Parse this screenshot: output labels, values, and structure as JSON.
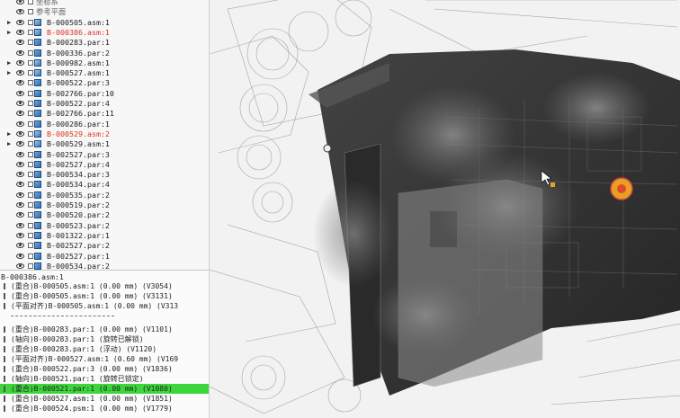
{
  "tree": {
    "top_items": [
      "坐标系",
      "参考平面"
    ],
    "rows": [
      {
        "label": "B-000505.asm:1",
        "kind": "asm",
        "expand": "▶",
        "state": "normal"
      },
      {
        "label": "B-000386.asm:1",
        "kind": "asm",
        "expand": "▶",
        "state": "red"
      },
      {
        "label": "B-000283.par:1",
        "kind": "par",
        "expand": "",
        "state": "normal"
      },
      {
        "label": "B-000336.par:2",
        "kind": "par",
        "expand": "",
        "state": "normal"
      },
      {
        "label": "B-000982.asm:1",
        "kind": "asm",
        "expand": "▶",
        "state": "normal"
      },
      {
        "label": "B-000527.asm:1",
        "kind": "asm",
        "expand": "▶",
        "state": "normal"
      },
      {
        "label": "B-000522.par:3",
        "kind": "par",
        "expand": "",
        "state": "normal"
      },
      {
        "label": "B-002766.par:10",
        "kind": "par",
        "expand": "",
        "state": "normal"
      },
      {
        "label": "B-000522.par:4",
        "kind": "par",
        "expand": "",
        "state": "normal"
      },
      {
        "label": "B-002766.par:11",
        "kind": "par",
        "expand": "",
        "state": "normal"
      },
      {
        "label": "B-000286.par:1",
        "kind": "par",
        "expand": "",
        "state": "normal"
      },
      {
        "label": "B-000529.asm:2",
        "kind": "asm",
        "expand": "▶",
        "state": "red"
      },
      {
        "label": "B-000529.asm:1",
        "kind": "asm",
        "expand": "▶",
        "state": "normal"
      },
      {
        "label": "B-002527.par:3",
        "kind": "par",
        "expand": "",
        "state": "normal"
      },
      {
        "label": "B-002527.par:4",
        "kind": "par",
        "expand": "",
        "state": "normal"
      },
      {
        "label": "B-000534.par:3",
        "kind": "par",
        "expand": "",
        "state": "normal"
      },
      {
        "label": "B-000534.par:4",
        "kind": "par",
        "expand": "",
        "state": "normal"
      },
      {
        "label": "B-000535.par:2",
        "kind": "par",
        "expand": "",
        "state": "normal"
      },
      {
        "label": "B-000519.par:2",
        "kind": "par",
        "expand": "",
        "state": "normal"
      },
      {
        "label": "B-000520.par:2",
        "kind": "par",
        "expand": "",
        "state": "normal"
      },
      {
        "label": "B-000523.par:2",
        "kind": "par",
        "expand": "",
        "state": "normal"
      },
      {
        "label": "B-001322.par:1",
        "kind": "par",
        "expand": "",
        "state": "normal"
      },
      {
        "label": "B-002527.par:2",
        "kind": "par",
        "expand": "",
        "state": "normal"
      },
      {
        "label": "B-002527.par:1",
        "kind": "par",
        "expand": "",
        "state": "normal"
      },
      {
        "label": "B-000534.par:2",
        "kind": "par",
        "expand": "",
        "state": "normal"
      }
    ]
  },
  "constraints": {
    "title": "B-000386.asm:1",
    "rows": [
      {
        "text": "(重合)B-000505.asm:1   (0.00 mm)   (V3054)",
        "hl": false
      },
      {
        "text": "(重合)B-000505.asm:1   (0.00 mm)   (V3131)",
        "hl": false
      },
      {
        "text": "(平面对齐)B-000505.asm:1   (0.00 mm)   (V313",
        "hl": false
      },
      {
        "text": "(重合)B-000283.par:1   (0.00 mm)   (V1101)",
        "hl": false
      },
      {
        "text": "(轴向)B-000283.par:1     (旋转已解锁)",
        "hl": false
      },
      {
        "text": "(重合)B-000283.par:1     (浮动)   (V1120)",
        "hl": false
      },
      {
        "text": "(平面对齐)B-000527.asm:1   (0.60 mm)   (V169",
        "hl": false
      },
      {
        "text": "(重合)B-000522.par:3   (0.00 mm)   (V1836)",
        "hl": false
      },
      {
        "text": "(轴向)B-000521.par:1     (旋转已锁定)",
        "hl": false
      },
      {
        "text": "(重合)B-000521.par:1   (0.00 mm)   (V1080)",
        "hl": true
      },
      {
        "text": "(重合)B-000527.asm:1   (0.00 mm)   (V1851)",
        "hl": false
      },
      {
        "text": "(重合)B-000524.psm:1   (0.00 mm)   (V1779)",
        "hl": false
      }
    ]
  },
  "colors": {
    "highlight": "#3cd63c",
    "error_text": "#e0331f",
    "selected_row": "#dbe8f8"
  }
}
